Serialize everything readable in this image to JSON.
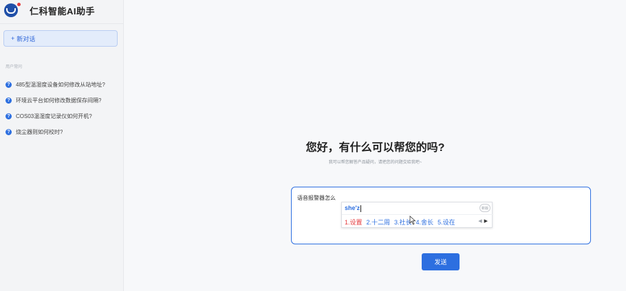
{
  "app": {
    "title": "仁科智能AI助手"
  },
  "sidebar": {
    "new_chat_label": "新对话",
    "section_label": "用户常问",
    "questions": [
      "485型温湿度设备如何修改从站地址?",
      "环境云平台如何修改数据保存间隔?",
      "COS03温湿度记录仪如何开机?",
      "烧尘器则如何校时?"
    ]
  },
  "main": {
    "greeting": "您好，有什么可以帮您的吗?",
    "subtext": "我可以帮您解答产品疑问，请把您的问题交给我吧~",
    "composer": {
      "value": "语音报警器怎么"
    },
    "ime": {
      "pinyin": "she'z",
      "badge": "新版",
      "candidates": [
        "1.设置",
        "2.十二周",
        "3.社长",
        "4.舍长",
        "5.设在"
      ]
    },
    "send_label": "发送"
  },
  "colors": {
    "accent": "#2d6fe0",
    "brand": "#1f4fa8",
    "highlight": "#e4393c"
  }
}
